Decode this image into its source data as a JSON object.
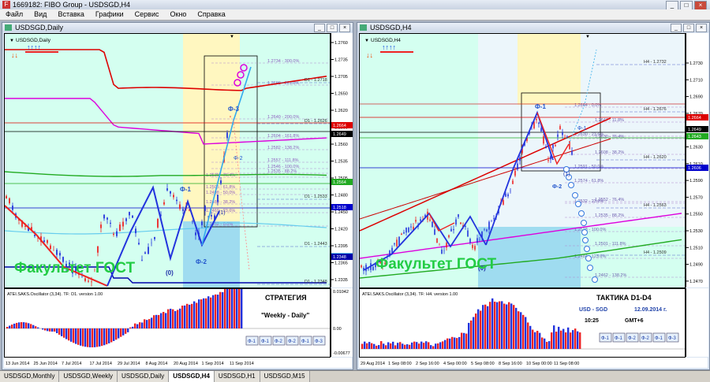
{
  "window": {
    "title": "1669182: FIBO Group - USDSGD,H4",
    "icon": "app-icon"
  },
  "menu": [
    "Файл",
    "Вид",
    "Вставка",
    "Графики",
    "Сервис",
    "Окно",
    "Справка"
  ],
  "left": {
    "title": "USDSGD,Daily",
    "symbol_label": "USDSGD,Daily",
    "watermark": "Факультет ГОСТ",
    "strategy_title": "СТРАТЕГИЯ",
    "strategy_sub": "\"Weekly - Daily\"",
    "osc_label": "ATEI.SAKS.Oscillator (3,34). TF: D1. version 1.00",
    "osc_scale": {
      "top": "0.01042",
      "zero": "0.00",
      "bottom": "-0.00677"
    },
    "phi_buttons": [
      "Ф-1",
      "Ф-1",
      "Ф-2",
      "Ф-2",
      "Ф-1",
      "Ф-3"
    ],
    "ticks": [
      "1.2760",
      "1.2735",
      "1.2705",
      "1.2650",
      "1.2620",
      "1.2590",
      "1.2560",
      "1.2535",
      "1.2505",
      "1.2480",
      "1.2450",
      "1.2420",
      "1.2395",
      "1.2365",
      "1.2335"
    ],
    "price_tags": [
      "1.2664",
      "1.2649",
      "1.2564",
      "1.2518",
      "1.2443",
      "1.2348"
    ],
    "dates": [
      "13 Jun 2014",
      "25 Jun 2014",
      "7 Jul 2014",
      "17 Jul 2014",
      "29 Jul 2014",
      "8 Aug 2014",
      "20 Aug 2014",
      "1 Sep 2014",
      "11 Sep 2014"
    ],
    "fib_labels": [
      "1.2734 - 300.0%",
      "1.2698 - 261.8%",
      "1.2640 - 200.0%",
      "1.2604 - 161.8%",
      "1.2582 - 138.2%",
      "1.2557 - 111.8%",
      "1.2546 - 100.0%",
      "1.2535 - 88.2%",
      "1.2530 - 76.4%",
      "1.2505 - 61.8%",
      "1.2498 - 50.0%",
      "1.2480 - 38.2%",
      "1.2469 - 23.6%",
      "1.2452 - 0.0%"
    ],
    "level_labels": [
      "D1 - 1.2718",
      "D1 - 1.2626",
      "D1 - 1.2533",
      "D1 - 1.2443",
      "D1 - 1.2348"
    ],
    "wave_labels": [
      "Ф-3",
      "Ф-1",
      "Ф-2",
      "Ф-1",
      "Ф-2",
      "(1)",
      "(0)"
    ]
  },
  "right": {
    "title": "USDSGD,H4",
    "symbol_label": "USDSGD,H4",
    "watermark": "Факультет ГОСТ",
    "tactic_title": "ТАКТИКА D1-D4",
    "pair": "USD - SGD",
    "date": "12.09.2014 г.",
    "time": "10:25",
    "tz": "GMT+6",
    "osc_label": "ATEI.SAKS.Oscillator (3,34). TF: H4. version 1.00",
    "phi_buttons": [
      "Ф-1",
      "Ф-1",
      "Ф-2",
      "Ф-2",
      "Ф-1",
      "Ф-3"
    ],
    "ticks": [
      "1.2730",
      "1.2710",
      "1.2690",
      "1.2670",
      "1.2650",
      "1.2630",
      "1.2610",
      "1.2590",
      "1.2570",
      "1.2550",
      "1.2530",
      "1.2510",
      "1.2490",
      "1.2470",
      "1.2450"
    ],
    "price_tags": [
      "1.2664",
      "1.2649",
      "1.2643",
      "1.2606"
    ],
    "dates": [
      "29 Aug 2014",
      "1 Sep 08:00",
      "2 Sep 16:00",
      "4 Sep 00:00",
      "5 Sep 08:00",
      "8 Sep 16:00",
      "10 Sep 00:00",
      "11 Sep 08:00"
    ],
    "fib_labels": [
      "1.2664 - 0.0%",
      "1.2647 - 11.8%",
      "1.2630 - 23.6%",
      "1.2630 - 76.4%",
      "1.2591 - 50.0%",
      "1.2608 - 38.2%",
      "1.2574 - 61.8%",
      "1.2552 - 76.4%",
      "1.2532 - 23.6%",
      "1.2535 - 88.2%",
      "1.2518 - 100.0%",
      "1.2501 - 111.8%",
      "1.2484 - 123.6%",
      "1.2462 - 138.2%"
    ],
    "level_labels": [
      "H4 - 1.2732",
      "H4 - 1.2676",
      "H4 - 1.2620",
      "H4 - 1.2563",
      "H4 - 1.2509",
      "H4 - 1.2453"
    ],
    "wave_labels": [
      "Ф-1",
      "Ф-1",
      "Ф-2",
      "(1)",
      "(0)"
    ]
  },
  "tabs": [
    "USDSGD,Monthly",
    "USDSGD,Weekly",
    "USDSGD,Daily",
    "USDSGD,H4",
    "USDSGD,H1",
    "USDSGD,M15"
  ],
  "active_tab": "USDSGD,H4",
  "colors": {
    "plot_bg": "#d4fff0",
    "up_bar": "#2233dd",
    "down_bar": "#ee2222",
    "red_ma": "#dd0000",
    "magenta_ma": "#dd00dd",
    "green_ma": "#22aa22",
    "navy_ma": "#0000aa",
    "zone_yellow": "#fff7c0",
    "zone_cyan": "#9fdcf0"
  }
}
